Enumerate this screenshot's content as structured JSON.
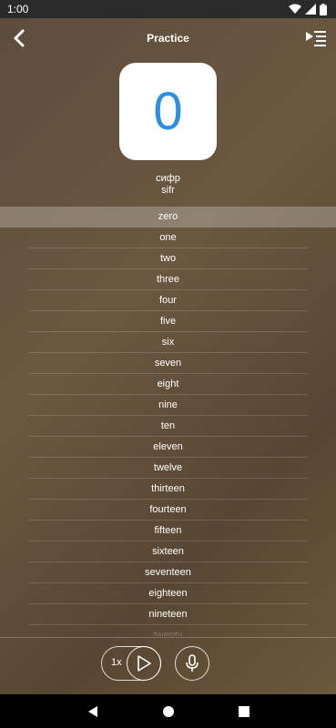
{
  "status_bar": {
    "time": "1:00"
  },
  "app_bar": {
    "title": "Practice"
  },
  "card": {
    "digit": "0"
  },
  "word": {
    "native": "сифр",
    "transliteration": "sifr"
  },
  "numbers": [
    {
      "label": "zero"
    },
    {
      "label": "one"
    },
    {
      "label": "two"
    },
    {
      "label": "three"
    },
    {
      "label": "four"
    },
    {
      "label": "five"
    },
    {
      "label": "six"
    },
    {
      "label": "seven"
    },
    {
      "label": "eight"
    },
    {
      "label": "nine"
    },
    {
      "label": "ten"
    },
    {
      "label": "eleven"
    },
    {
      "label": "twelve"
    },
    {
      "label": "thirteen"
    },
    {
      "label": "fourteen"
    },
    {
      "label": "fifteen"
    },
    {
      "label": "sixteen"
    },
    {
      "label": "seventeen"
    },
    {
      "label": "eighteen"
    },
    {
      "label": "nineteen"
    },
    {
      "label": "twenty"
    }
  ],
  "selected_index": 0,
  "controls": {
    "speed": "1x"
  },
  "colors": {
    "accent": "#2d8fe3",
    "card_bg": "#ffffff"
  },
  "icons": {
    "back": "back-arrow-icon",
    "menu": "play-list-icon",
    "play": "play-icon",
    "mic": "microphone-icon"
  }
}
